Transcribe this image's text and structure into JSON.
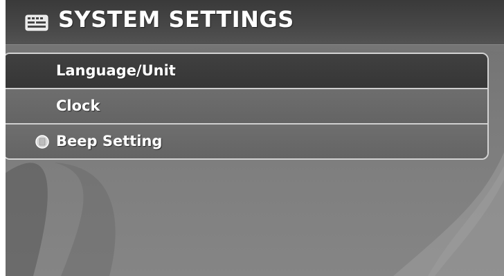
{
  "header": {
    "title": "SYSTEM SETTINGS",
    "icon": "keyboard-settings-icon"
  },
  "menu": {
    "items": [
      {
        "label": "Language/Unit",
        "selected": true,
        "indicator": false
      },
      {
        "label": "Clock",
        "selected": false,
        "indicator": false
      },
      {
        "label": "Beep Setting",
        "selected": false,
        "indicator": true,
        "indicator_icon": "indicator-light-icon"
      }
    ]
  },
  "colors": {
    "header_bg": "#474747",
    "highlight_bg": "#3a3a3a",
    "item_bg": "#6a6a6a",
    "border": "#d4d4d4",
    "text": "#ffffff"
  }
}
